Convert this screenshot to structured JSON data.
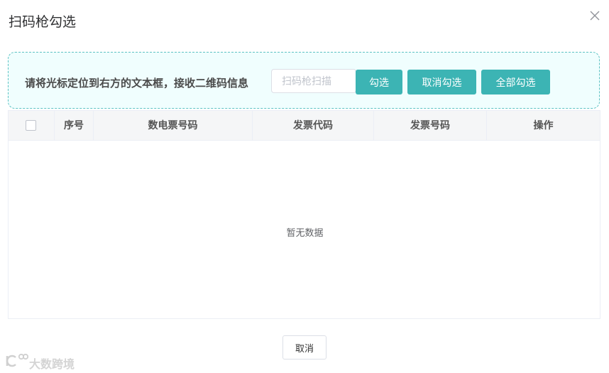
{
  "dialog": {
    "title": "扫码枪勾选"
  },
  "scan_panel": {
    "instruction": "请将光标定位到右方的文本框，接收二维码信息",
    "input_placeholder": "扫码枪扫描",
    "input_value": "",
    "buttons": {
      "select": "勾选",
      "deselect": "取消勾选",
      "select_all": "全部勾选"
    }
  },
  "table": {
    "columns": [
      "序号",
      "数电票号码",
      "发票代码",
      "发票号码",
      "操作"
    ],
    "rows": [],
    "empty_text": "暂无数据"
  },
  "footer": {
    "cancel_label": "取消"
  },
  "watermark": {
    "text": "大数跨境"
  },
  "colors": {
    "accent": "#3cb4b4",
    "panel_border": "#5cc2c3",
    "panel_bg": "#f0fefe"
  },
  "icons": [
    "close-icon",
    "watermark-logo-icon"
  ]
}
